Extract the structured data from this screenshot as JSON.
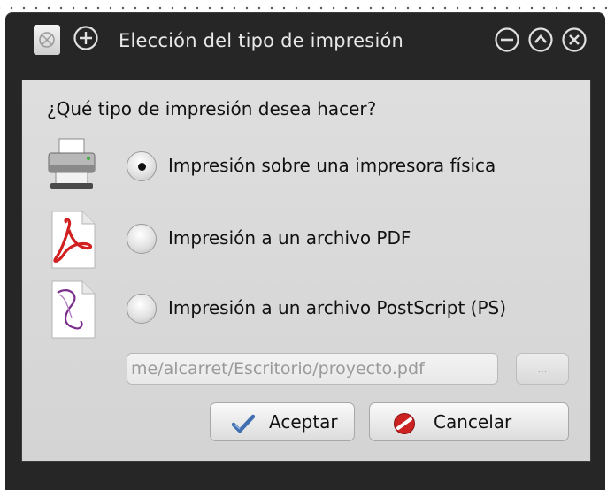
{
  "window": {
    "title": "Elección del tipo de impresión",
    "icons": {
      "app": "document-icon",
      "plus": "plus-circle-icon",
      "minimize": "minimize-circle-icon",
      "maximize": "maximize-circle-icon",
      "close": "close-circle-icon"
    }
  },
  "dialog": {
    "question": "¿Qué tipo de impresión desea hacer?",
    "options": [
      {
        "label": "Impresión sobre una impresora física",
        "icon": "printer-icon",
        "selected": true
      },
      {
        "label": "Impresión a un archivo PDF",
        "icon": "pdf-file-icon",
        "selected": false
      },
      {
        "label": "Impresión a un archivo PostScript (PS)",
        "icon": "postscript-file-icon",
        "selected": false
      }
    ],
    "file_path": "me/alcarret/Escritorio/proyecto.pdf",
    "browse_label": "...",
    "accept_label": "Aceptar",
    "accept_icon": "checkmark-icon",
    "cancel_label": "Cancelar",
    "cancel_icon": "cancel-icon"
  },
  "colors": {
    "titlebar": "#262626",
    "dialog_bg": "#d9d9d9",
    "accept_check": "#3f6fb0",
    "cancel_red": "#cc2222"
  }
}
